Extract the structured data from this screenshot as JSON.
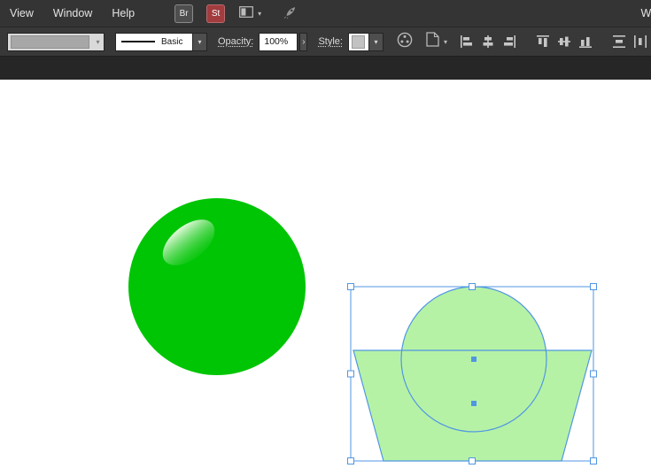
{
  "menubar": {
    "menus": [
      {
        "label": "View"
      },
      {
        "label": "Window"
      },
      {
        "label": "Help"
      }
    ],
    "bridge_label": "Br",
    "stock_label": "St",
    "workspace_chevron": "▾",
    "right_text": "We"
  },
  "control_bar": {
    "stroke_style_value": "Basic",
    "opacity_label": "Opacity:",
    "opacity_value": "100%",
    "more_glyph": "›",
    "style_label": "Style:",
    "chevron_glyph": "▾"
  },
  "artboard": {
    "ball": {
      "fill": "#00c505",
      "highlight_top": "#e3f9dc",
      "highlight_bottom": "#53d653"
    },
    "selection": {
      "shape_fill": "#b6f2a6",
      "outline": "#4f96e3",
      "handle_fill": "#ffffff"
    }
  }
}
